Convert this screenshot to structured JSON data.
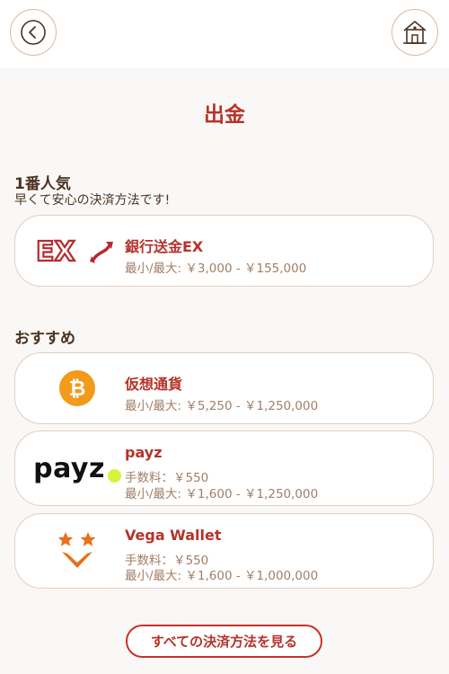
{
  "header": {
    "back_icon": "chevron-left-icon",
    "home_icon": "home-icon"
  },
  "page": {
    "title": "出金"
  },
  "popular": {
    "title": "1番人気",
    "subtitle": "早くて安心の決済方法です!",
    "methods": [
      {
        "name": "銀行送金EX",
        "limits": "最小/最大: ￥3,000 - ￥155,000",
        "logo_text": "EX",
        "logo_color": "#b8282e"
      }
    ]
  },
  "recommended": {
    "title": "おすすめ",
    "methods": [
      {
        "name": "仮想通貨",
        "limits": "最小/最大: ￥5,250 - ￥1,250,000",
        "logo_color": "#f29a1a"
      },
      {
        "name": "payz",
        "fee": "手数料：￥550",
        "limits": "最小/最大: ￥1,600 - ￥1,250,000",
        "logo_text": "payz",
        "logo_dot_color": "#d4f43a"
      },
      {
        "name": "Vega Wallet",
        "fee": "手数料：￥550",
        "limits": "最小/最大: ￥1,600 - ￥1,000,000",
        "logo_color": "#e8701a"
      }
    ]
  },
  "actions": {
    "see_all": "すべての決済方法を見る"
  },
  "colors": {
    "accent": "#b5332a",
    "border": "#e2cfc0",
    "background": "#faf8f6"
  }
}
